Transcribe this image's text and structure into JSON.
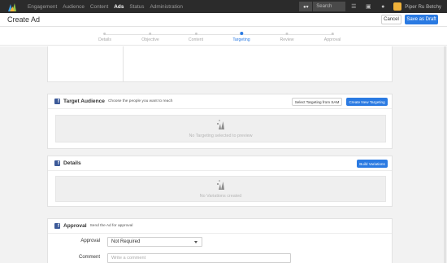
{
  "nav": {
    "items": [
      "Engagement",
      "Audience",
      "Content",
      "Ads",
      "Status",
      "Administration"
    ],
    "active_index": 3,
    "search_placeholder": "Search",
    "user_name": "Piper Ru Betchy"
  },
  "header": {
    "title": "Create Ad",
    "cancel_label": "Cancel",
    "save_label": "Save as Draft"
  },
  "stepper": {
    "steps": [
      "Details",
      "Objective",
      "Content",
      "Targeting",
      "Review",
      "Approval"
    ],
    "active_index": 3
  },
  "target_audience": {
    "title": "Target Audience",
    "subtitle": "Choose the people you want to reach",
    "select_button": "Select Targeting from SAM",
    "create_button": "Create New Targeting",
    "empty_text": "No Targeting selected to preview"
  },
  "details": {
    "title": "Details",
    "build_button": "Build Variations",
    "empty_text": "No Variations created"
  },
  "approval": {
    "title": "Approval",
    "subtitle": "Send the Ad for approval",
    "approval_label": "Approval",
    "approval_value": "Not Required",
    "comment_label": "Comment",
    "comment_placeholder": "Write a comment"
  },
  "colors": {
    "accent": "#2a7ae2",
    "topbar": "#2b2b2b",
    "facebook": "#3b5998"
  }
}
